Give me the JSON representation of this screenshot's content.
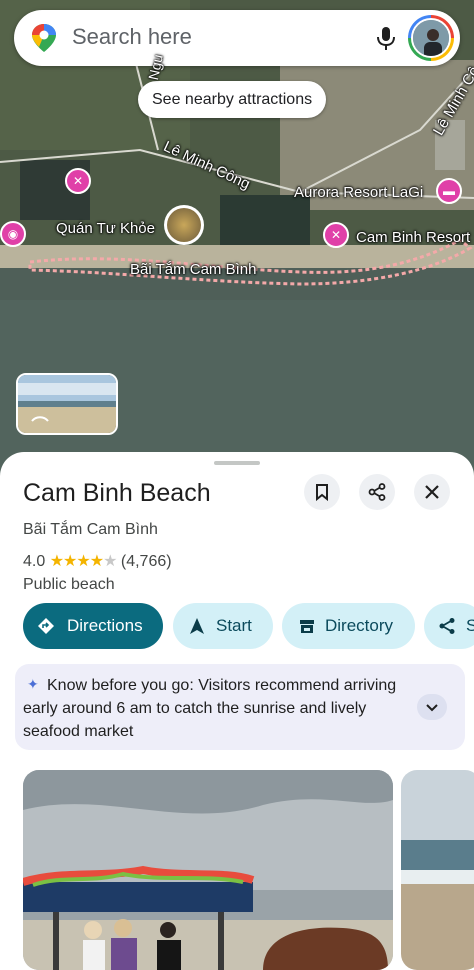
{
  "search": {
    "placeholder": "Search here"
  },
  "map": {
    "nearby_button": "See nearby attractions",
    "labels": {
      "road_le_minh_cong": "Lê Minh Công",
      "road_le_minh_cong_2": "Lê Minh Cô",
      "road_nguyen": "Ngu",
      "aurora": "Aurora Resort LaGi",
      "quan_tu_khoe": "Quán Tư Khỏe",
      "cam_binh_resort": "Cam Binh Resort",
      "bai_tam": "Bãi Tắm Cam Bình"
    }
  },
  "place": {
    "name": "Cam Binh Beach",
    "local_name": "Bãi Tắm Cam Bình",
    "rating": "4.0",
    "rating_stars": 4,
    "review_count": "(4,766)",
    "category": "Public beach",
    "tip": "Know before you go: Visitors recommend arriving early around 6 am to catch the sunrise and lively seafood market"
  },
  "actions": {
    "directions": "Directions",
    "start": "Start",
    "directory": "Directory",
    "share": "S"
  },
  "colors": {
    "primary_chip": "#0b6b7f",
    "secondary_chip": "#d3f0f7",
    "poi": "#e040a8",
    "star": "#f4b400"
  }
}
